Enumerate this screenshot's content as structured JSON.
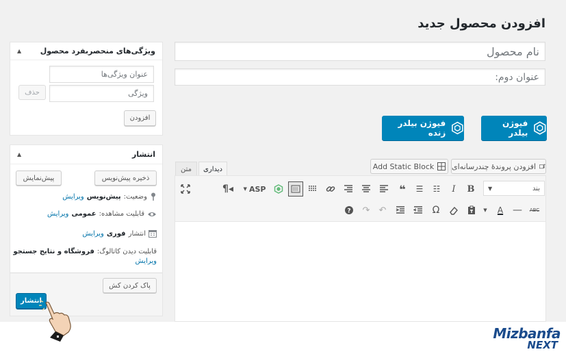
{
  "header": {
    "title": "افزودن محصول جدید"
  },
  "title_field": {
    "placeholder": "نام محصول"
  },
  "subtitle_field": {
    "placeholder": "عنوان دوم:"
  },
  "fusion": {
    "builder_label": "فیوژن بیلدر",
    "live_label": "فیوژن بیلدر زنده"
  },
  "editor": {
    "tabs": [
      {
        "label": "دیداری",
        "active": true
      },
      {
        "label": "متن",
        "active": false
      }
    ],
    "add_media_label": "افزودن پروندهٔ چندرسانه‌ای",
    "add_static_block_label": "Add Static Block",
    "format_select": {
      "value": "بند"
    },
    "asp_label": "ASP"
  },
  "features_box": {
    "title": "ویژگی‌های منحصربفرد محصول",
    "title_input_placeholder": "عنوان ویژگی‌ها",
    "feature_input_placeholder": "ویژگی",
    "delete_label": "حذف",
    "add_label": "افزودن"
  },
  "publish_box": {
    "title": "انتشار",
    "save_draft_label": "ذخیره پیش‌نویس",
    "preview_label": "پیش‌نمایش",
    "status_label": "وضعیت:",
    "status_value": "پیش‌نویس",
    "visibility_label": "قابلیت مشاهده:",
    "visibility_value": "عمومی",
    "publish_when_label": "انتشار",
    "publish_when_value": "فوری",
    "catalog_label": "قابلیت دیدن کاتالوگ:",
    "catalog_value": "فروشگاه و نتایج جستجو",
    "edit_label": "ویرایش",
    "clear_cache_label": "پاک کردن کش",
    "publish_label": "انتشار"
  },
  "watermark": {
    "line1": "Mizbanfa",
    "line2": "NEXT"
  },
  "colors": {
    "primary": "#0085ba",
    "link": "#0073aa",
    "logo_blue": "#1a4b8c"
  }
}
